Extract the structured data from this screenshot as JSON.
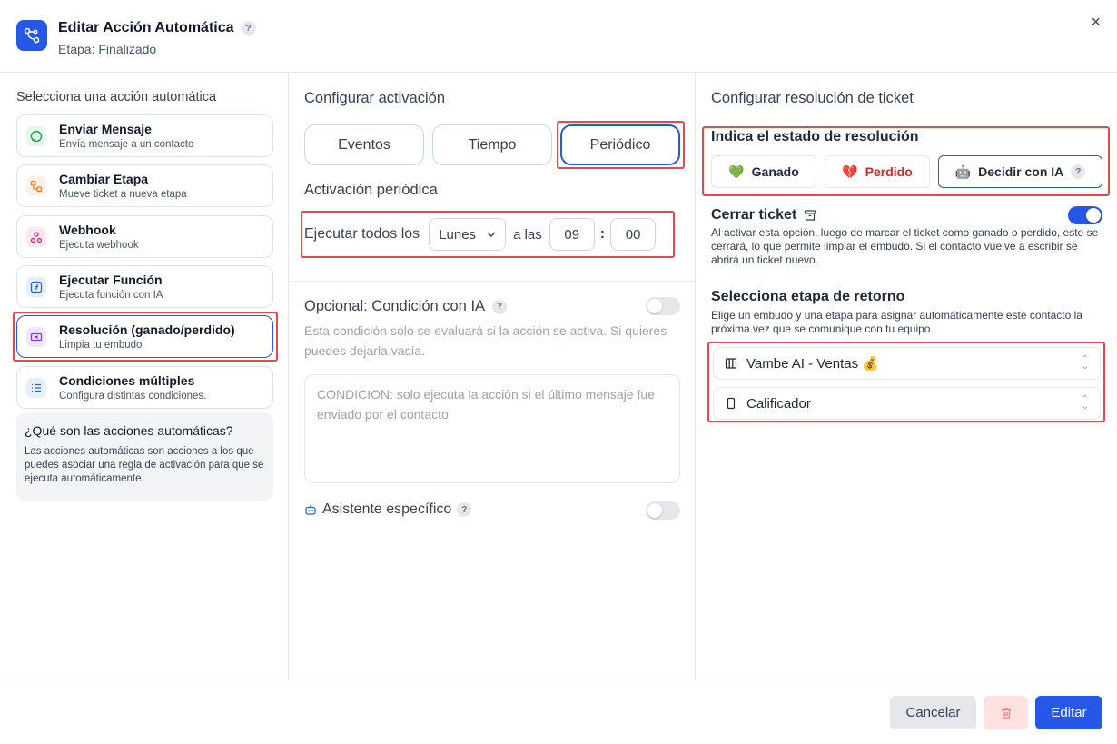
{
  "header": {
    "title": "Editar Acción Automática",
    "subtitle": "Etapa: Finalizado",
    "help": "?",
    "close": "×"
  },
  "left": {
    "section_title": "Selecciona una acción automática",
    "actions": [
      {
        "label": "Enviar Mensaje",
        "desc": "Envía mensaje a un contacto",
        "icon": "message-circle-icon"
      },
      {
        "label": "Cambiar Etapa",
        "desc": "Mueve ticket a nueva etapa",
        "icon": "move-stage-icon"
      },
      {
        "label": "Webhook",
        "desc": "Ejecuta webhook",
        "icon": "webhook-icon"
      },
      {
        "label": "Ejecutar Función",
        "desc": "Ejecuta función con IA",
        "icon": "function-icon"
      },
      {
        "label": "Resolución (ganado/perdido)",
        "desc": "Limpia tu embudo",
        "icon": "ticket-icon"
      },
      {
        "label": "Condiciones múltiples",
        "desc": "Configura distintas condiciones.",
        "icon": "list-icon"
      }
    ],
    "info_title": "¿Qué son las acciones automáticas?",
    "info_text": "Las acciones automáticas son acciones a los que puedes asociar una regla de activación para que se ejecuta automáticamente."
  },
  "middle": {
    "section_title": "Configurar activación",
    "tabs": [
      "Eventos",
      "Tiempo",
      "Periódico"
    ],
    "periodic_title": "Activación periódica",
    "run_every_label": "Ejecutar todos los",
    "day_value": "Lunes",
    "at_label": "a las",
    "hour": "09",
    "colon": ":",
    "minute": "00",
    "optional_title": "Opcional: Condición con IA",
    "optional_desc": "Esta condición solo se evaluará si la acción se activa. Si quieres puedes dejarla vacía.",
    "condition_placeholder": "CONDICION: solo ejecuta la acción si el último mensaje fue enviado por el contacto",
    "assistant_label": "Asistente específico"
  },
  "right": {
    "section_title": "Configurar resolución de ticket",
    "state_title": "Indica el estado de resolución",
    "won": "Ganado",
    "lost": "Perdido",
    "ai_decide": "Decidir con IA",
    "close_ticket_title": "Cerrar ticket",
    "close_ticket_desc": "Al activar esta opción, luego de marcar el ticket como ganado o perdido, este se cerrará, lo que permite limpiar el embudo. Si el contacto vuelve a escribir se abrirá un ticket nuevo.",
    "close_ticket_on": true,
    "return_stage_title": "Selecciona etapa de retorno",
    "return_stage_desc": "Elige un embudo y una etapa para asignar automáticamente este contacto la próxima vez que se comunique con tu equipo.",
    "funnel": "Vambe AI - Ventas 💰",
    "stage": "Calificador"
  },
  "footer": {
    "cancel": "Cancelar",
    "edit": "Editar"
  },
  "colors": {
    "primary": "#2557e8",
    "highlight": "#e5484d",
    "delete_bg": "#fde2e2"
  }
}
